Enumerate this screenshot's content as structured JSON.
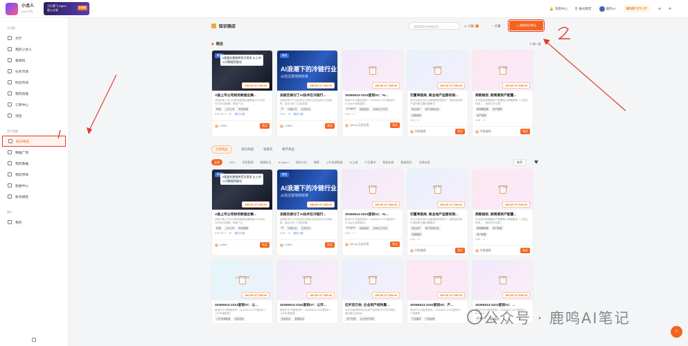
{
  "topbar": {
    "brand_name": "小龙人",
    "brand_sub": "AAA 平台",
    "promo_line1": "万亿赛飞 Agent",
    "promo_line2": "星火计划",
    "promo_tag": "去看看",
    "messages": "消息中心",
    "account": "账号绑定",
    "user": "鹿鸣AI",
    "coins": "¥0.00",
    "points": "976",
    "points_unit": "UT"
  },
  "sidebar": {
    "section1": "主功能",
    "section2": "资产管理",
    "section3": "账户",
    "items": [
      "大厅",
      "我的小龙人",
      "邀请码",
      "任务市场",
      "时间市场",
      "我的技能",
      "订单中心",
      "消息"
    ],
    "items2": [
      "知识商店",
      "数据广场",
      "我的数据",
      "我的项目",
      "收益中心",
      "账号绑定"
    ],
    "items3": [
      "我的"
    ]
  },
  "header": {
    "title": "知识商店",
    "search_placeholder": "搜索商品名称或标签...",
    "orders": "订购",
    "orders_badge": "0",
    "market": "行情",
    "publish": "我的知识商品"
  },
  "featured": {
    "title": "精选",
    "refresh": "换一批"
  },
  "cards": [
    {
      "title": "A股上市公司财务数据全集...",
      "desc": "该知识库上市公司财务数据全集覆盖1997年至2025年全周期，覆盖了全...",
      "tags": [
        "财报",
        "上市公司",
        "财务数据"
      ],
      "stats": "0.59 ★5.0 ⋯67",
      "buy": "官方入驻",
      "author": "UJNKI",
      "price": "198.00 UT ¥45.00",
      "thumb_title": "A股量化数据库官方直发 从上市公司数据到量化"
    },
    {
      "title": "该报告探讨了AI技术在冷链行...",
      "desc": "该报告探讨了AI技术在冷链行业的应用与未来趋势，重点分析了当前发展...",
      "tags": [
        "AI",
        "冷链行业",
        "生成式AI"
      ],
      "stats": "0.86 ⋯14",
      "buy": "官方入驻",
      "author": "UJNKI",
      "price": "198.00 UT ¥45.00",
      "big": "AI浪潮下的冷链行业",
      "small": "从前沿落地到效率"
    },
    {
      "title": "20260613-2223复刻01：AI...",
      "desc": "原创中文可复用资料：20260613-2223复刻01：AI Agent 探索复刻...",
      "tags": [
        "AI Agent",
        "探索复刻",
        "自动化工作流"
      ],
      "stats": "0.81 ⋯0",
      "author": "ai6.my 后台负责",
      "price": "100.00 UT ¥45.00",
      "cat": "AI Agent"
    },
    {
      "title": "空置率困局_商业地产运营有限...",
      "desc": "本文为商业地产运营管理员提供了一套系统的商户结构和空置问题解决...",
      "tags": [
        "商业地产",
        "商户结构优化"
      ],
      "tags2": [
        "空置管理"
      ],
      "stats": "0.81 ⋯0",
      "author": "你靠偏离!",
      "price": "100.00 UT ¥45.00",
      "cat": "商业地产"
    },
    {
      "title": "周期规划_跨周期资产配置...",
      "desc": "本文提出跨周期资产配置核心策略框架「三层结构体」，指导在多空周...",
      "tags": [
        "跨周期配置",
        "资产配置"
      ],
      "tags2": [
        "资产配置"
      ],
      "stats": "0.85 ⋯0",
      "author": "你靠偏离!",
      "price": "100.00 UT ¥45.00",
      "cat": "资产配置"
    }
  ],
  "tabs": [
    "全部商品",
    "知识商品",
    "技能包",
    "数字商品"
  ],
  "filters": [
    "全部",
    "SEO",
    "项目管理",
    "数据标注",
    "AI Agent",
    "测试方向",
    "建模",
    "公开来源数据",
    "AI工具",
    "产品需求",
    "智能合规",
    "数据清洗",
    "法律合规"
  ],
  "sort": "推荐",
  "row3": [
    {
      "cat": "公开来源数据",
      "title": "20260613-2223复刻07：公...",
      "desc": "原创中文可复用资料：20260613-2223复刻07：公开来源数据...",
      "tags": [
        "公开来源数据",
        "信息获证"
      ],
      "price": "100.00 UT ¥45.00"
    },
    {
      "cat": "信息获证",
      "title": "20260613-2152复刻07：公开...",
      "desc": "原创中文可复用资料：20260613-2152复刻07：公开来源数据...",
      "tags": [
        "信息获证",
        "数据验证"
      ],
      "price": "100.00 UT ¥45.00"
    },
    {
      "cat": "资产处理",
      "title": "杠杆双刃剑_企业资产结构重...",
      "desc": "本文为首席财务企业资产结构审计与杠杆风险，通过建立系统化...",
      "tags": [
        "资产处理",
        "企业资产结构"
      ],
      "price": "100.00 UT ¥45.00"
    },
    {
      "cat": "产品需求",
      "title": "20260613-2152复刻02：产...",
      "desc": "原创中文可复用资料：20260613-2152复刻02：产品需求...",
      "tags": [
        "产品需求",
        "产品经理"
      ],
      "price": "100.00 UT ¥45.00"
    },
    {
      "cat": "AI Agent",
      "title": "20260613-2223复刻01：...",
      "desc": "原创中文可复用资料：20260613-2223复刻01：AI Agent...",
      "tags": [
        "AI Agent",
        "探索复刻"
      ],
      "price": "100.00 UT ¥45.00"
    }
  ],
  "buy_label": "购买",
  "featured_badge": "精选",
  "watermark": "公众号 · 鹿鸣AI笔记",
  "annotations": {
    "one": "1",
    "two": "2"
  },
  "colors": {
    "accent": "#f5641e",
    "annotation": "#e03a2a"
  }
}
